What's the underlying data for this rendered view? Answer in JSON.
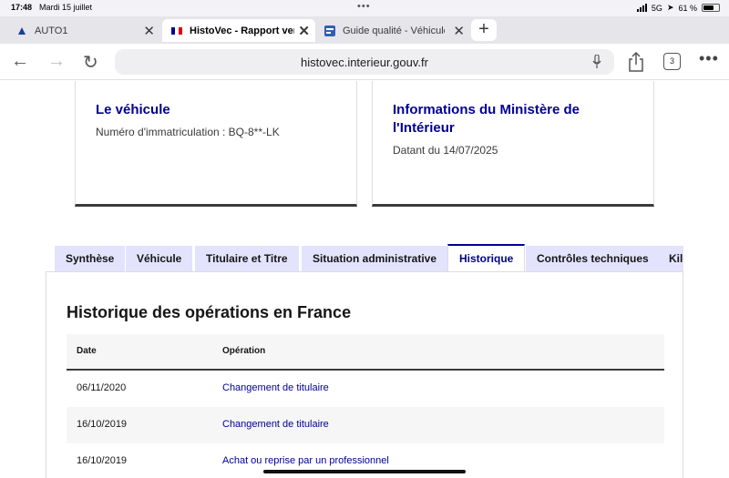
{
  "status": {
    "time": "17:48",
    "date": "Mardi 15 juillet",
    "network": "5G",
    "battery": "61 %"
  },
  "browser_tabs": [
    {
      "title": "AUTO1",
      "active": false,
      "icon": "auto1-favicon"
    },
    {
      "title": "HistoVec - Rapport vend",
      "active": true,
      "icon": "french-flag-favicon"
    },
    {
      "title": "Guide qualité - Véhicule",
      "active": false,
      "icon": "guide-favicon"
    }
  ],
  "toolbar": {
    "url": "histovec.interieur.gouv.fr",
    "tab_count": "3"
  },
  "cards": {
    "vehicle": {
      "title": "Le véhicule",
      "subtitle": "Numéro d'immatriculation : BQ-8**-LK"
    },
    "ministry": {
      "title": "Informations du Ministère de l'Intérieur",
      "subtitle": "Datant du 14/07/2025"
    }
  },
  "page_tabs": [
    "Synthèse",
    "Véhicule",
    "Titulaire et Titre",
    "Situation administrative",
    "Historique",
    "Contrôles techniques",
    "Kilo"
  ],
  "active_page_tab": "Historique",
  "history": {
    "title": "Historique des opérations en France",
    "columns": {
      "date": "Date",
      "operation": "Opération"
    },
    "rows": [
      {
        "date": "06/11/2020",
        "operation": "Changement de titulaire"
      },
      {
        "date": "16/10/2019",
        "operation": "Changement de titulaire"
      },
      {
        "date": "16/10/2019",
        "operation": "Achat ou reprise par un professionnel"
      }
    ]
  },
  "colors": {
    "accent": "#000091",
    "tab_inactive": "#e3e3fd"
  }
}
